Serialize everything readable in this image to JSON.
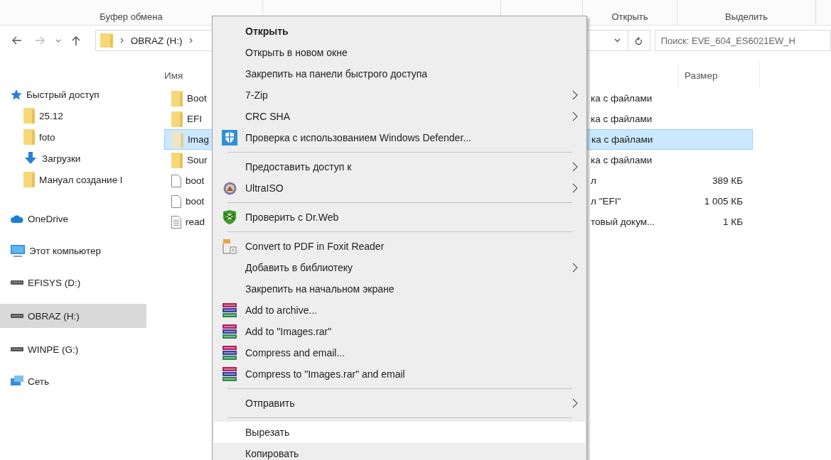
{
  "ribbon": {
    "groups": [
      "Буфер обмена",
      "Открыть",
      "Выделить"
    ]
  },
  "address": {
    "crumbs": [
      "OBRAZ (H:)"
    ],
    "search_placeholder": "Поиск: EVE_604_ES6021EW_H"
  },
  "sidebar": {
    "items": [
      {
        "label": "Быстрый доступ",
        "kind": "quick",
        "selected": false,
        "children": [
          {
            "label": "25.12",
            "kind": "folder",
            "selected": false
          },
          {
            "label": "foto",
            "kind": "folder",
            "selected": false
          },
          {
            "label": "Загрузки",
            "kind": "downloads",
            "selected": false
          },
          {
            "label": "Мануал создание l",
            "kind": "folder",
            "selected": false
          }
        ]
      },
      {
        "label": "OneDrive",
        "kind": "cloud",
        "selected": false
      },
      {
        "label": "Этот компьютер",
        "kind": "computer",
        "selected": false
      },
      {
        "label": "EFISYS (D:)",
        "kind": "drive",
        "selected": false
      },
      {
        "label": "OBRAZ (H:)",
        "kind": "drive",
        "selected": true
      },
      {
        "label": "WINPE (G:)",
        "kind": "drive",
        "selected": false
      },
      {
        "label": "Сеть",
        "kind": "network",
        "selected": false
      }
    ]
  },
  "files": {
    "columns": [
      "Имя",
      "Размер"
    ],
    "rows": [
      {
        "name": "Boot",
        "type": "ка с файлами",
        "size": "",
        "kind": "folder",
        "selected": false
      },
      {
        "name": "EFI",
        "type": "ка с файлами",
        "size": "",
        "kind": "folder",
        "selected": false
      },
      {
        "name": "Imag",
        "type": "ка с файлами",
        "size": "",
        "kind": "folder",
        "selected": true
      },
      {
        "name": "Sour",
        "type": "ка с файлами",
        "size": "",
        "kind": "folder",
        "selected": false
      },
      {
        "name": "boot",
        "type": "л",
        "size": "389 КБ",
        "kind": "file",
        "selected": false
      },
      {
        "name": "boot",
        "type": "л \"EFI\"",
        "size": "1 005 КБ",
        "kind": "file",
        "selected": false
      },
      {
        "name": "read",
        "type": "товый докум...",
        "size": "1 КБ",
        "kind": "text",
        "selected": false
      }
    ]
  },
  "context_menu": {
    "items": [
      {
        "kind": "plain",
        "label": "Открыть",
        "default": true,
        "submenu": false,
        "highlighted": false
      },
      {
        "kind": "plain",
        "label": "Открыть в новом окне",
        "default": false,
        "submenu": false,
        "highlighted": false
      },
      {
        "kind": "plain",
        "label": "Закрепить на панели быстрого доступа",
        "default": false,
        "submenu": false,
        "highlighted": false
      },
      {
        "kind": "plain",
        "label": "7-Zip",
        "default": false,
        "submenu": true,
        "highlighted": false
      },
      {
        "kind": "plain",
        "label": "CRC SHA",
        "default": false,
        "submenu": true,
        "highlighted": false
      },
      {
        "kind": "defender",
        "label": "Проверка с использованием Windows Defender...",
        "default": false,
        "submenu": false,
        "highlighted": false
      },
      {
        "kind": "separator"
      },
      {
        "kind": "plain",
        "label": "Предоставить доступ к",
        "default": false,
        "submenu": true,
        "highlighted": false
      },
      {
        "kind": "ultraiso",
        "label": "UltraISO",
        "default": false,
        "submenu": true,
        "highlighted": false
      },
      {
        "kind": "separator"
      },
      {
        "kind": "drweb",
        "label": "Проверить с Dr.Web",
        "default": false,
        "submenu": false,
        "highlighted": false
      },
      {
        "kind": "separator"
      },
      {
        "kind": "foxit",
        "label": "Convert to PDF in Foxit Reader",
        "default": false,
        "submenu": false,
        "highlighted": false
      },
      {
        "kind": "plain",
        "label": "Добавить в библиотеку",
        "default": false,
        "submenu": true,
        "highlighted": false
      },
      {
        "kind": "plain",
        "label": "Закрепить на начальном экране",
        "default": false,
        "submenu": false,
        "highlighted": false
      },
      {
        "kind": "winrar",
        "label": "Add to archive...",
        "default": false,
        "submenu": false,
        "highlighted": false
      },
      {
        "kind": "winrar",
        "label": "Add to \"Images.rar\"",
        "default": false,
        "submenu": false,
        "highlighted": false
      },
      {
        "kind": "winrar",
        "label": "Compress and email...",
        "default": false,
        "submenu": false,
        "highlighted": false
      },
      {
        "kind": "winrar",
        "label": "Compress to \"Images.rar\" and email",
        "default": false,
        "submenu": false,
        "highlighted": false
      },
      {
        "kind": "separator"
      },
      {
        "kind": "plain",
        "label": "Отправить",
        "default": false,
        "submenu": true,
        "highlighted": false
      },
      {
        "kind": "separator"
      },
      {
        "kind": "plain",
        "label": "Вырезать",
        "default": false,
        "submenu": false,
        "highlighted": true
      },
      {
        "kind": "plain",
        "label": "Копировать",
        "default": false,
        "submenu": false,
        "highlighted": false
      }
    ]
  }
}
